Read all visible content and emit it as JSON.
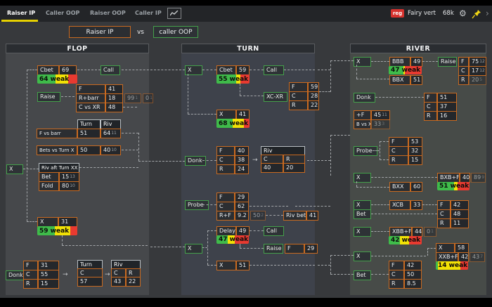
{
  "topbar": {
    "tabs": [
      {
        "label": "Raiser IP",
        "active": true
      },
      {
        "label": "Caller OOP",
        "active": false
      },
      {
        "label": "Raiser OOP",
        "active": false
      },
      {
        "label": "Caller IP",
        "active": false
      }
    ],
    "badge": "reg",
    "user": "Fairy vert",
    "count": "68k",
    "icons": [
      "chart-icon",
      "gear-icon",
      "pin-icon",
      "chevron-right-icon"
    ]
  },
  "matchup": {
    "left": "Raiser IP",
    "vs": "vs",
    "right": "caller OOP"
  },
  "colors": {
    "tab_accent": "#e6d000",
    "orange": "#c96a20",
    "green": "#44a04a",
    "bar_green": "#3fbb4a",
    "bar_yellow": "#f2e205",
    "bar_red": "#e83a30",
    "badge_red": "#d6322e"
  },
  "flop": {
    "title": "FLOP",
    "cbet": {
      "l": "Cbet",
      "v": "69"
    },
    "call": "Call",
    "cbet_bar": {
      "text": "64 weak",
      "g": 45,
      "y": 32,
      "r": 23
    },
    "raise": "Raise",
    "vsr": [
      {
        "l": "F",
        "v": "41"
      },
      {
        "l": "R+barr",
        "v": "18"
      },
      {
        "l": "C vs XR",
        "v": "48"
      }
    ],
    "vsr_x1": {
      "v": "99",
      "s": "1"
    },
    "vsr_x2": {
      "v": "0",
      "s": "1"
    },
    "tr_head": {
      "turn": "Turn",
      "riv": "Riv"
    },
    "fvsbarr": {
      "l": "F vs barr",
      "turn": "51",
      "riv": "64",
      "riv_s": "11"
    },
    "betsvs": {
      "l": "Bets vs Turn X",
      "turn": "50",
      "riv": "40",
      "riv_s": "10"
    },
    "x_left": "X",
    "rivaft": {
      "head": "Riv aft Turn XX",
      "rows": [
        {
          "l": "Bet",
          "v": "15",
          "s": "13"
        },
        {
          "l": "Fold",
          "v": "80",
          "s": "10"
        }
      ]
    },
    "xnode": {
      "l": "X",
      "v": "31"
    },
    "x_bar": {
      "text": "59 weak",
      "g": 44,
      "y": 38,
      "r": 18
    },
    "donk": "Donk",
    "donk_rows": [
      {
        "l": "F",
        "v": "31"
      },
      {
        "l": "C",
        "v": "55"
      },
      {
        "l": "R",
        "v": "15"
      }
    ],
    "arrow": "→",
    "turn_mini": {
      "head": "Turn",
      "l": "C",
      "v": "57"
    },
    "riv_mini": {
      "head": "Riv",
      "c1": "C",
      "c2": "R",
      "v1": "43",
      "v2": "22"
    }
  },
  "turn": {
    "title": "TURN",
    "x1": "X",
    "cbet": {
      "l": "Cbet",
      "v": "59"
    },
    "cbet_bar": {
      "text": "55 weak",
      "g": 60,
      "y": 12,
      "r": 28
    },
    "call1": "Call",
    "xcxr": "XC-XR",
    "xcxr_rows": [
      {
        "l": "F",
        "v": "59"
      },
      {
        "l": "C",
        "v": "28"
      },
      {
        "l": "R",
        "v": "22"
      }
    ],
    "xnode": {
      "l": "X",
      "v": "41"
    },
    "x_bar": {
      "text": "68 weak",
      "g": 48,
      "y": 36,
      "r": 16
    },
    "donk": "Donk",
    "donk_rows": [
      {
        "l": "F",
        "v": "40"
      },
      {
        "l": "C",
        "v": "38"
      },
      {
        "l": "R",
        "v": "24"
      }
    ],
    "arrow": "→",
    "riv_mini": {
      "head": "Riv",
      "c1": "C",
      "c2": "R",
      "v1": "40",
      "v2": "20"
    },
    "probe": "Probe",
    "probe_rows": [
      {
        "l": "F",
        "v": "29"
      },
      {
        "l": "C",
        "v": "62"
      },
      {
        "l": "R+F",
        "v": "9.2"
      }
    ],
    "probe_x": {
      "v": "50",
      "s": "2"
    },
    "rivbet": {
      "l": "Riv bet",
      "v": "41"
    },
    "delay": {
      "l": "Delay",
      "v": "49"
    },
    "delay_bar": {
      "text": "47 weak",
      "g": 35,
      "y": 22,
      "r": 43
    },
    "call2": "Call",
    "raise": {
      "l": "Raise",
      "f": "F",
      "v": "29"
    },
    "x2": "X",
    "xnode2": {
      "l": "X",
      "v": "51"
    }
  },
  "river": {
    "title": "RIVER",
    "x1": "X",
    "bbb": {
      "l": "BBB",
      "v": "49"
    },
    "bbb_bar": {
      "text": "47 weak",
      "g": 44,
      "y": 6,
      "r": 50
    },
    "bbx": {
      "l": "BBX",
      "v": "51"
    },
    "raise": "Raise",
    "raise_rows": [
      {
        "l": "F",
        "v": "75",
        "s": "12"
      },
      {
        "l": "C",
        "v": "17",
        "s": "12"
      },
      {
        "l": "R",
        "v": "20",
        "s": "5"
      }
    ],
    "donk": "Donk",
    "donk_rows": [
      {
        "l": "F",
        "v": "51"
      },
      {
        "l": "C",
        "v": "37"
      },
      {
        "l": "R",
        "v": "16"
      }
    ],
    "plusf": {
      "l": "+F",
      "v": "45",
      "s": "11"
    },
    "bvsx": {
      "l": "B vs X",
      "v": "33",
      "s": "3"
    },
    "probe": "Probe",
    "probe_rows": [
      {
        "l": "F",
        "v": "53"
      },
      {
        "l": "C",
        "v": "32"
      },
      {
        "l": "R",
        "v": "15"
      }
    ],
    "x2": "X",
    "bxbf": {
      "l": "BXB+F",
      "v": "40"
    },
    "bxbf_x": {
      "v": "89",
      "s": "9"
    },
    "bxbf_bar": {
      "text": "51 weak",
      "g": 52,
      "y": 11,
      "r": 37
    },
    "bxx": {
      "l": "BXX",
      "v": "60"
    },
    "x3": "X",
    "xcb": {
      "l": "XCB",
      "v": "33"
    },
    "bet1": "Bet",
    "bet1_rows": [
      {
        "l": "F",
        "v": "42"
      },
      {
        "l": "C",
        "v": "48"
      },
      {
        "l": "R",
        "v": "11"
      }
    ],
    "x4": "X",
    "xbbf": {
      "l": "XBB+F",
      "v": "44"
    },
    "xbbf_x": {
      "v": "0",
      "s": "1"
    },
    "xbbf_bar": {
      "text": "42 weak",
      "g": 35,
      "y": 27,
      "r": 38
    },
    "x58": {
      "l": "X",
      "v": "58"
    },
    "x5": "X",
    "xxbf": {
      "l": "XXB+F",
      "v": "42"
    },
    "xxbf_x": {
      "v": "43",
      "s": "7"
    },
    "xxbf_bar": {
      "text": "14 weak",
      "g": 6,
      "y": 70,
      "r": 24
    },
    "bet2": "Bet",
    "bet2_rows": [
      {
        "l": "F",
        "v": "42"
      },
      {
        "l": "C",
        "v": "50"
      },
      {
        "l": "R",
        "v": "8.5"
      }
    ]
  }
}
